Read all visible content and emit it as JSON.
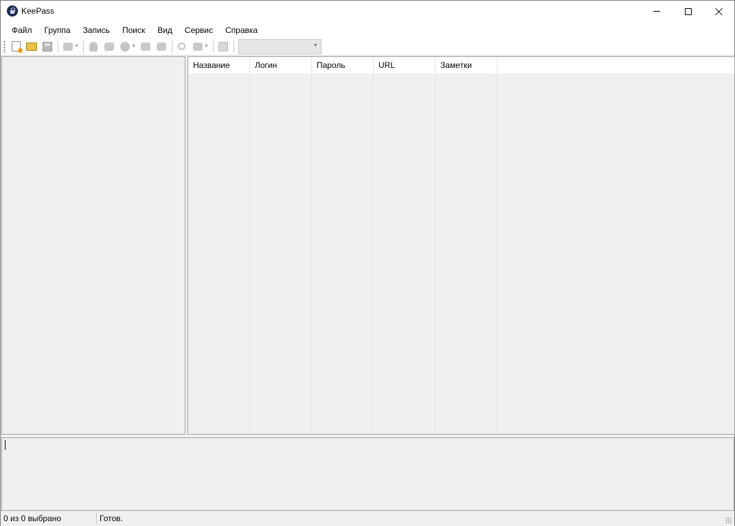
{
  "window": {
    "title": "KeePass",
    "icons": {
      "app": "keepass-lock-icon",
      "minimize": "minimize-icon",
      "maximize": "maximize-icon",
      "close": "close-icon"
    }
  },
  "menu": {
    "items": [
      "Файл",
      "Группа",
      "Запись",
      "Поиск",
      "Вид",
      "Сервис",
      "Справка"
    ]
  },
  "toolbar": {
    "icons": [
      "new-database-icon",
      "open-database-icon",
      "save-icon",
      "sync-icon",
      "add-entry-icon",
      "edit-entry-icon",
      "delete-entry-icon",
      "copy-username-icon",
      "copy-password-icon",
      "find-icon",
      "show-entries-icon",
      "lock-icon"
    ],
    "quick_find_value": ""
  },
  "entries": {
    "columns": [
      "Название",
      "Логин",
      "Пароль",
      "URL",
      "Заметки"
    ],
    "rows": []
  },
  "status": {
    "selection": "0 из 0 выбрано",
    "state": "Готов."
  }
}
